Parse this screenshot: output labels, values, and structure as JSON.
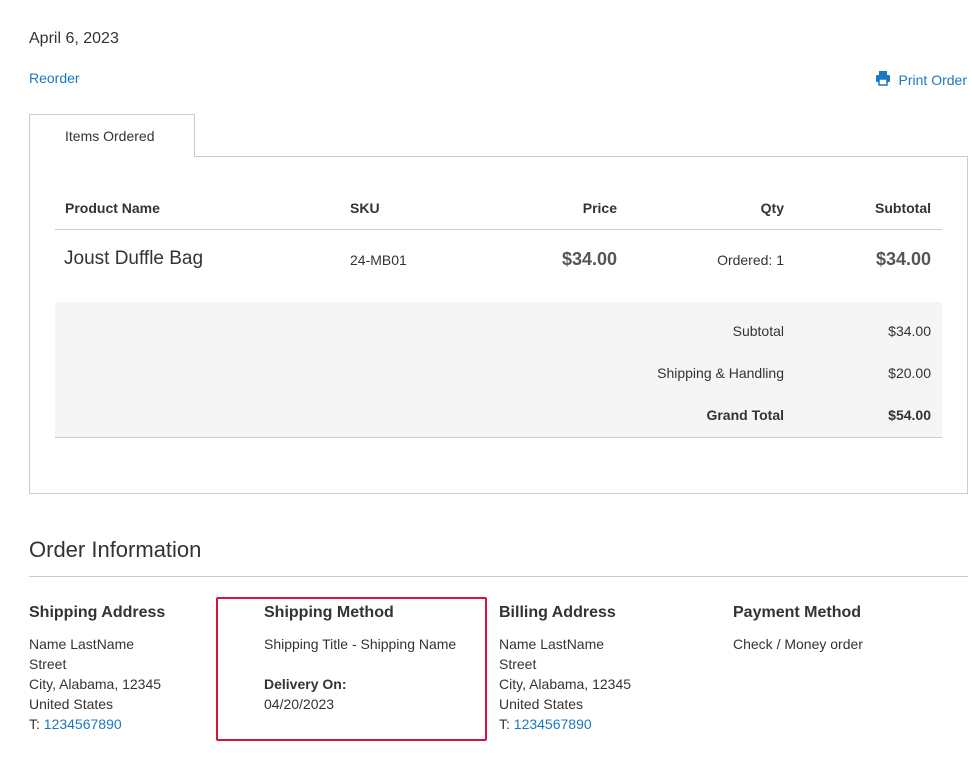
{
  "order": {
    "date": "April 6, 2023"
  },
  "actions": {
    "reorder": "Reorder",
    "print_order": "Print Order"
  },
  "tabs": {
    "items_ordered": "Items Ordered"
  },
  "table": {
    "headers": {
      "product_name": "Product Name",
      "sku": "SKU",
      "price": "Price",
      "qty": "Qty",
      "subtotal": "Subtotal"
    },
    "rows": [
      {
        "name": "Joust Duffle Bag",
        "sku": "24-MB01",
        "price": "$34.00",
        "qty": "Ordered: 1",
        "subtotal": "$34.00"
      }
    ]
  },
  "totals": {
    "subtotal_label": "Subtotal",
    "subtotal_value": "$34.00",
    "shipping_label": "Shipping & Handling",
    "shipping_value": "$20.00",
    "grand_label": "Grand Total",
    "grand_value": "$54.00"
  },
  "info": {
    "title": "Order Information",
    "shipping_address": {
      "title": "Shipping Address",
      "name": "Name LastName",
      "street": "Street",
      "city": "City, Alabama, 12345",
      "country": "United States",
      "phone_prefix": "T:",
      "phone": "1234567890"
    },
    "shipping_method": {
      "title": "Shipping Method",
      "method": "Shipping Title - Shipping Name",
      "delivery_label": "Delivery On:",
      "delivery_date": "04/20/2023"
    },
    "billing_address": {
      "title": "Billing Address",
      "name": "Name LastName",
      "street": "Street",
      "city": "City, Alabama, 12345",
      "country": "United States",
      "phone_prefix": "T:",
      "phone": "1234567890"
    },
    "payment_method": {
      "title": "Payment Method",
      "method": "Check / Money order"
    }
  },
  "colors": {
    "link": "#1979c3",
    "highlight": "#d0143c",
    "totals_bg": "#f5f5f5"
  }
}
